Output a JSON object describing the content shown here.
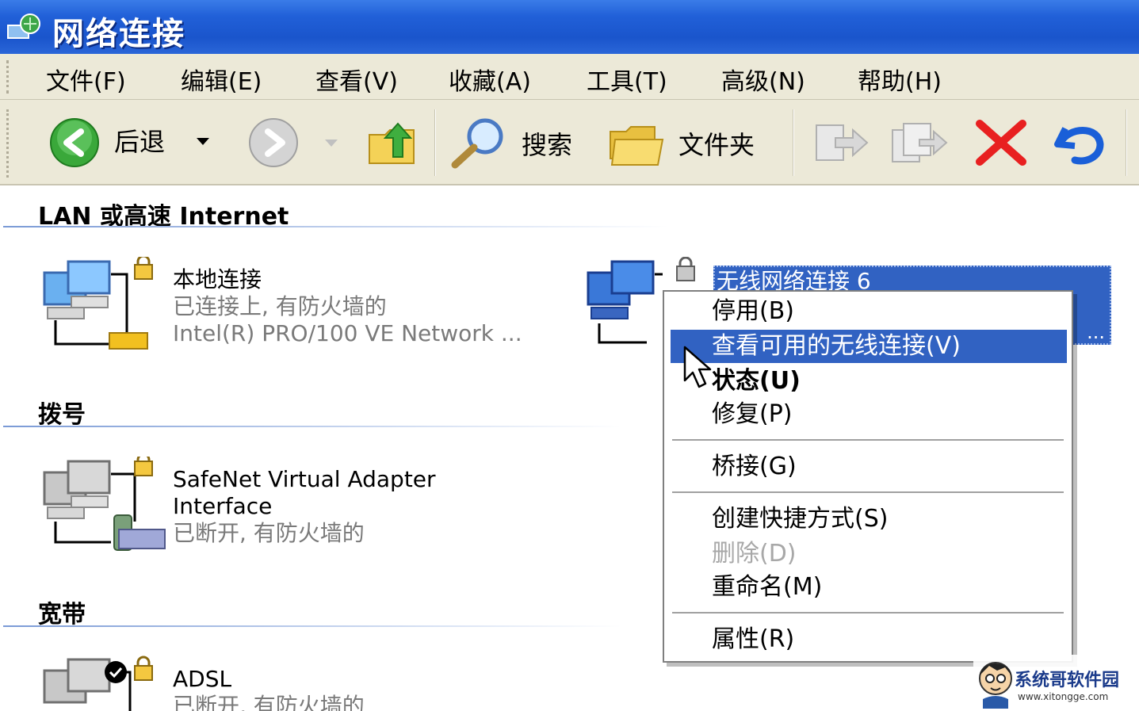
{
  "window": {
    "title": "网络连接"
  },
  "menubar": {
    "items": [
      "文件(F)",
      "编辑(E)",
      "查看(V)",
      "收藏(A)",
      "工具(T)",
      "高级(N)",
      "帮助(H)"
    ]
  },
  "toolbar": {
    "back_label": "后退",
    "search_label": "搜索",
    "folders_label": "文件夹"
  },
  "groups": [
    {
      "header": "LAN 或高速 Internet",
      "connections": [
        {
          "name": "本地连接",
          "status": "已连接上, 有防火墙的",
          "device": "Intel(R) PRO/100 VE Network ..."
        },
        {
          "name": "无线网络连接 6",
          "device_ellipsis": "..."
        }
      ]
    },
    {
      "header": "拨号",
      "connections": [
        {
          "name_line1": "SafeNet Virtual Adapter",
          "name_line2": "Interface",
          "status": "已断开, 有防火墙的"
        }
      ]
    },
    {
      "header": "宽带",
      "connections": [
        {
          "name": "ADSL",
          "status": "已断开, 有防火墙的"
        }
      ]
    }
  ],
  "context_menu": {
    "items": [
      {
        "label": "停用(B)",
        "state": "normal"
      },
      {
        "label": "查看可用的无线连接(V)",
        "state": "highlighted"
      },
      {
        "label": "状态(U)",
        "state": "default"
      },
      {
        "label": "修复(P)",
        "state": "normal"
      },
      {
        "label": "桥接(G)",
        "state": "normal"
      },
      {
        "label": "创建快捷方式(S)",
        "state": "normal"
      },
      {
        "label": "删除(D)",
        "state": "disabled"
      },
      {
        "label": "重命名(M)",
        "state": "normal"
      },
      {
        "label": "属性(R)",
        "state": "normal"
      }
    ]
  },
  "watermark": {
    "name": "系统哥软件园",
    "url": "www.xitongge.com"
  },
  "colors": {
    "title_bar": "#2160d8",
    "selection": "#3162c2",
    "chrome": "#ece9d8"
  }
}
